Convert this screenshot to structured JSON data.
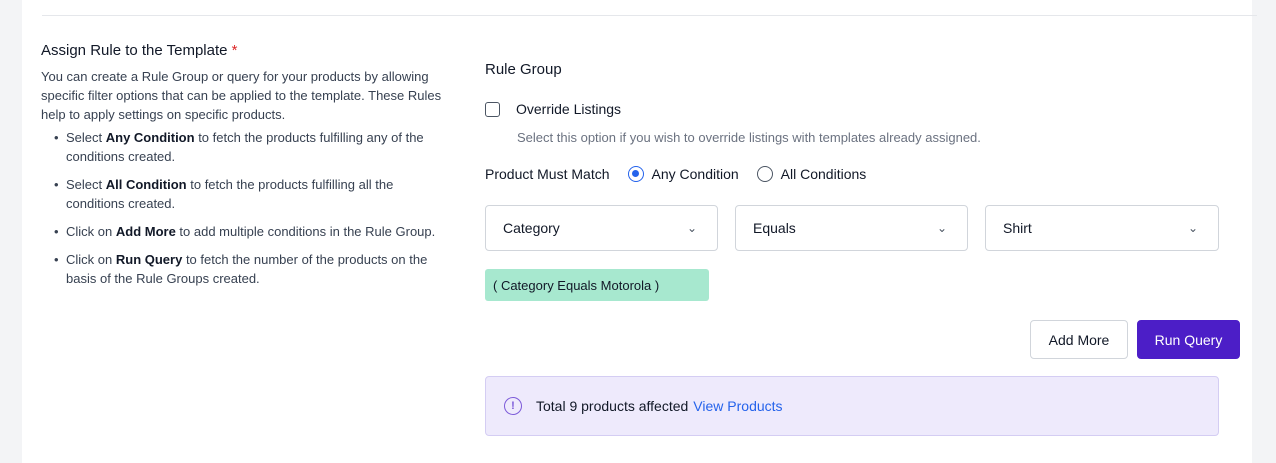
{
  "left": {
    "title": "Assign Rule to the Template",
    "required_mark": "*",
    "description": "You can create a Rule Group or query for your products by allowing specific filter options that can be applied to the template. These Rules help to apply settings on specific products.",
    "bullets": [
      {
        "pre": "Select ",
        "bold": "Any Condition",
        "post": " to fetch the products fulfilling any of the conditions created."
      },
      {
        "pre": "Select ",
        "bold": "All Condition",
        "post": " to fetch the products fulfilling all the conditions created."
      },
      {
        "pre": "Click on ",
        "bold": "Add More",
        "post": " to add multiple conditions in the Rule Group."
      },
      {
        "pre": "Click on ",
        "bold": "Run Query",
        "post": " to fetch the number of the products on the basis of the Rule Groups created."
      }
    ]
  },
  "right": {
    "title": "Rule Group",
    "override_label": "Override Listings",
    "override_help": "Select this option if you wish to override listings with templates already assigned.",
    "override_checked": false,
    "match_label": "Product Must Match",
    "match_options": [
      "Any Condition",
      "All Conditions"
    ],
    "match_selected": "Any Condition",
    "selects": {
      "attribute": "Category",
      "operator": "Equals",
      "value": "Shirt"
    },
    "condition_tag": "( Category Equals Motorola )",
    "add_more_label": "Add More",
    "run_query_label": "Run Query",
    "result_text": "Total 9 products affected",
    "result_link": "View Products"
  },
  "colors": {
    "primary_button": "#4c1ec7",
    "radio_selected": "#2563eb",
    "tag_bg": "#a7e8cf",
    "banner_bg": "#eeeafc",
    "required": "#dc2626"
  },
  "icons": {
    "info": "info-circle-icon",
    "select_arrow": "chevron-down-icon"
  }
}
